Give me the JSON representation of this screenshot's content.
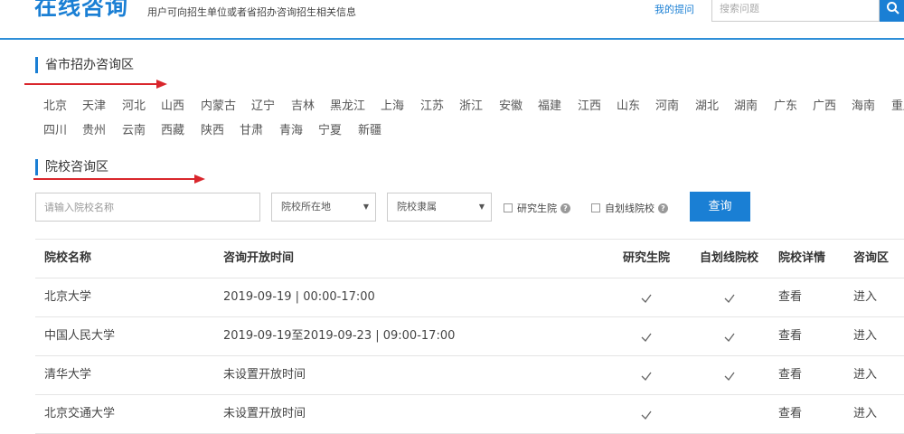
{
  "header": {
    "title": "在线咨询",
    "subtitle": "用户可向招生单位或者省招办咨询招生相关信息",
    "my_questions": "我的提问",
    "search_placeholder": "搜索问题"
  },
  "provincial": {
    "title": "省市招办咨询区",
    "row1": [
      "北京",
      "天津",
      "河北",
      "山西",
      "内蒙古",
      "辽宁",
      "吉林",
      "黑龙江",
      "上海",
      "江苏",
      "浙江",
      "安徽",
      "福建",
      "江西",
      "山东",
      "河南",
      "湖北",
      "湖南",
      "广东",
      "广西",
      "海南",
      "重庆"
    ],
    "row2": [
      "四川",
      "贵州",
      "云南",
      "西藏",
      "陕西",
      "甘肃",
      "青海",
      "宁夏",
      "新疆"
    ]
  },
  "school": {
    "title": "院校咨询区",
    "input_placeholder": "请输入院校名称",
    "location_select": "院校所在地",
    "affiliation_select": "院校隶属",
    "graduate_label": "研究生院",
    "self_line_label": "自划线院校",
    "query_button": "查询"
  },
  "table": {
    "headers": [
      "院校名称",
      "咨询开放时间",
      "研究生院",
      "自划线院校",
      "院校详情",
      "咨询区"
    ],
    "rows": [
      {
        "name": "北京大学",
        "time": "2019-09-19 | 00:00-17:00",
        "graduate": true,
        "self_line": true,
        "detail": "查看",
        "enter": "进入"
      },
      {
        "name": "中国人民大学",
        "time": "2019-09-19至2019-09-23 | 09:00-17:00",
        "graduate": true,
        "self_line": true,
        "detail": "查看",
        "enter": "进入"
      },
      {
        "name": "清华大学",
        "time": "未设置开放时间",
        "graduate": true,
        "self_line": true,
        "detail": "查看",
        "enter": "进入"
      },
      {
        "name": "北京交通大学",
        "time": "未设置开放时间",
        "graduate": true,
        "self_line": false,
        "detail": "查看",
        "enter": "进入"
      }
    ]
  },
  "colors": {
    "accent": "#1a7fd4",
    "arrow": "#d9262c"
  }
}
